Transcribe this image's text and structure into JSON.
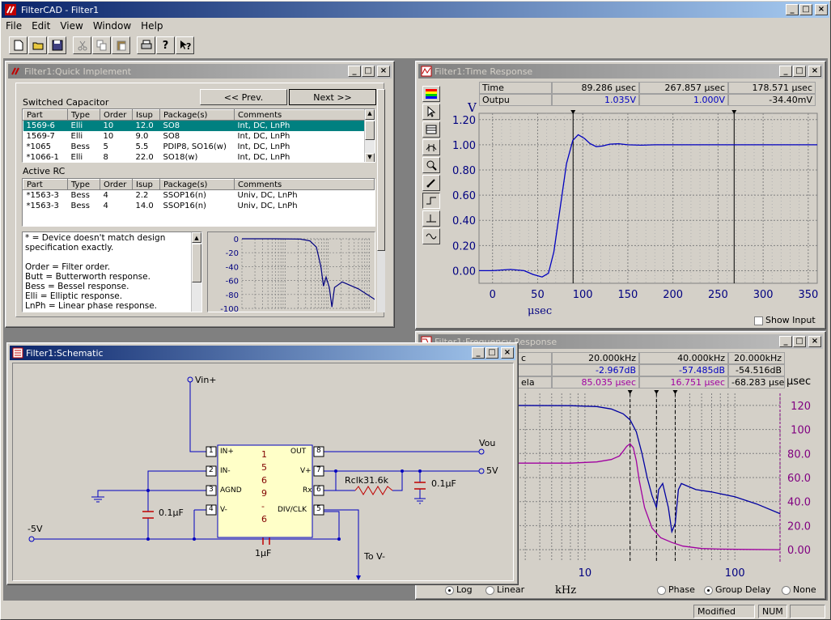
{
  "app": {
    "title": "FilterCAD - Filter1"
  },
  "menu": [
    "File",
    "Edit",
    "View",
    "Window",
    "Help"
  ],
  "quick": {
    "title": "Filter1:Quick Implement",
    "prev": "<< Prev.",
    "next": "Next >>",
    "sc_label": "Switched Capacitor",
    "rc_label": "Active RC",
    "headers": [
      "Part",
      "Type",
      "Order",
      "Isup",
      "Package(s)",
      "Comments"
    ],
    "sc_rows": [
      [
        "1569-6",
        "Elli",
        "10",
        "12.0",
        "SO8",
        "Int, DC, LnPh"
      ],
      [
        "1569-7",
        "Elli",
        "10",
        "9.0",
        "SO8",
        "Int, DC, LnPh"
      ],
      [
        "*1065",
        "Bess",
        "5",
        "5.5",
        "PDIP8, SO16(w)",
        "Int, DC, LnPh"
      ],
      [
        "*1066-1",
        "Elli",
        "8",
        "22.0",
        "SO18(w)",
        "Int, DC, LnPh"
      ]
    ],
    "rc_rows": [
      [
        "*1563-3",
        "Bess",
        "4",
        "2.2",
        "SSOP16(n)",
        "Univ, DC, LnPh"
      ],
      [
        "*1563-3",
        "Bess",
        "4",
        "14.0",
        "SSOP16(n)",
        "Univ, DC, LnPh"
      ]
    ],
    "notes": [
      "* = Device doesn't match design",
      "specification exactly.",
      "",
      "Order = Filter order.",
      "Butt = Butterworth response.",
      "Bess = Bessel response.",
      "Elli = Elliptic response.",
      "LnPh = Linear phase response."
    ],
    "mini_ticks": [
      "0",
      "-20",
      "-40",
      "-60",
      "-80",
      "-100"
    ]
  },
  "time": {
    "title": "Filter1:Time Response",
    "row1": [
      "Time",
      "89.286 μsec",
      "267.857 μsec",
      "178.571 μsec"
    ],
    "row2": [
      "Outpu",
      "1.035V",
      "1.000V",
      "-34.40mV"
    ],
    "ylabel": "V",
    "xlabel": "μsec",
    "show_input": "Show Input"
  },
  "freq": {
    "title": "Filter1:Frequency Response",
    "row1": [
      "c",
      "20.000kHz",
      "40.000kHz",
      "20.000kHz"
    ],
    "row2": [
      "",
      "-2.967dB",
      "-57.485dB",
      "-54.516dB"
    ],
    "row3": [
      "ela",
      "85.035 μsec",
      "16.751 μsec",
      "-68.283 μsec"
    ],
    "yunit": "μsec",
    "xlabel": "kHz",
    "opt_log": "Log",
    "opt_linear": "Linear",
    "opt_phase": "Phase",
    "opt_gd": "Group Delay",
    "opt_none": "None"
  },
  "schem": {
    "title": "Filter1:Schematic",
    "vin": "Vin+",
    "vout": "Vou",
    "v5": "5V",
    "vm5": "-5V",
    "tov": "To V-",
    "rclk": "Rclk31.6k",
    "c1": "0.1μF",
    "c2": "0.1μF",
    "c3": "1μF",
    "pins_l": [
      "IN+",
      "IN-",
      "AGND",
      "V-"
    ],
    "pins_r": [
      "OUT",
      "V+",
      "Rx",
      "DIV/CLK"
    ],
    "nums_l": [
      "1",
      "2",
      "3",
      "4"
    ],
    "nums_r": [
      "8",
      "7",
      "6",
      "5"
    ],
    "chip": [
      "1",
      "5",
      "6",
      "9",
      "-",
      "6"
    ]
  },
  "status": {
    "modified": "Modified",
    "num": "NUM"
  },
  "chart_data": [
    {
      "type": "line",
      "title": "",
      "xlabel": "μsec",
      "ylabel": "V",
      "xlim": [
        -15,
        360
      ],
      "ylim": [
        -0.1,
        1.25
      ],
      "x_ticks": [
        0,
        50,
        100,
        150,
        200,
        250,
        300,
        350
      ],
      "y_ticks": [
        0.0,
        0.2,
        0.4,
        0.6,
        0.8,
        1.0,
        1.2
      ],
      "cursors_x": [
        89.286,
        267.857
      ],
      "series": [
        {
          "x": [
            -15,
            0,
            20,
            35,
            45,
            55,
            62,
            68,
            75,
            82,
            89,
            95,
            102,
            108,
            115,
            122,
            130,
            140,
            150,
            165,
            180,
            200,
            360
          ],
          "y": [
            0,
            0,
            0.01,
            0.0,
            -0.03,
            -0.05,
            -0.02,
            0.15,
            0.5,
            0.85,
            1.035,
            1.08,
            1.05,
            1.01,
            0.985,
            0.99,
            1.005,
            1.008,
            1.0,
            0.997,
            1.0,
            1.0,
            1.0
          ]
        }
      ]
    },
    {
      "type": "line",
      "title": "",
      "xlabel": "kHz",
      "x_scale": "log",
      "xlim": [
        3,
        200
      ],
      "ylim": [
        -10,
        130
      ],
      "y_ticks": [
        0.0,
        20.0,
        40.0,
        60.0,
        80.0,
        100,
        120
      ],
      "x_ticks": [
        10,
        100
      ],
      "cursors_x": [
        20,
        40,
        30
      ],
      "series": [
        {
          "x": [
            3,
            8,
            12,
            15,
            18,
            20,
            22,
            24,
            26,
            28,
            29,
            30,
            31,
            33,
            36,
            38,
            40,
            42,
            44,
            48,
            55,
            70,
            100,
            140,
            200
          ],
          "y": [
            120,
            119.8,
            119,
            117,
            113,
            108,
            98,
            80,
            60,
            45,
            40,
            35,
            50,
            55,
            35,
            15,
            22,
            50,
            55,
            53,
            50,
            48,
            44,
            38,
            30
          ]
        },
        {
          "x": [
            3,
            8,
            12,
            15,
            17,
            18,
            19,
            20,
            21,
            22,
            23,
            25,
            28,
            32,
            38,
            45,
            60,
            80,
            120,
            200
          ],
          "y": [
            72,
            72,
            73,
            75,
            78,
            82,
            86,
            88,
            85,
            74,
            58,
            35,
            18,
            10,
            6,
            3,
            1,
            0.5,
            0.2,
            0
          ]
        }
      ]
    }
  ]
}
